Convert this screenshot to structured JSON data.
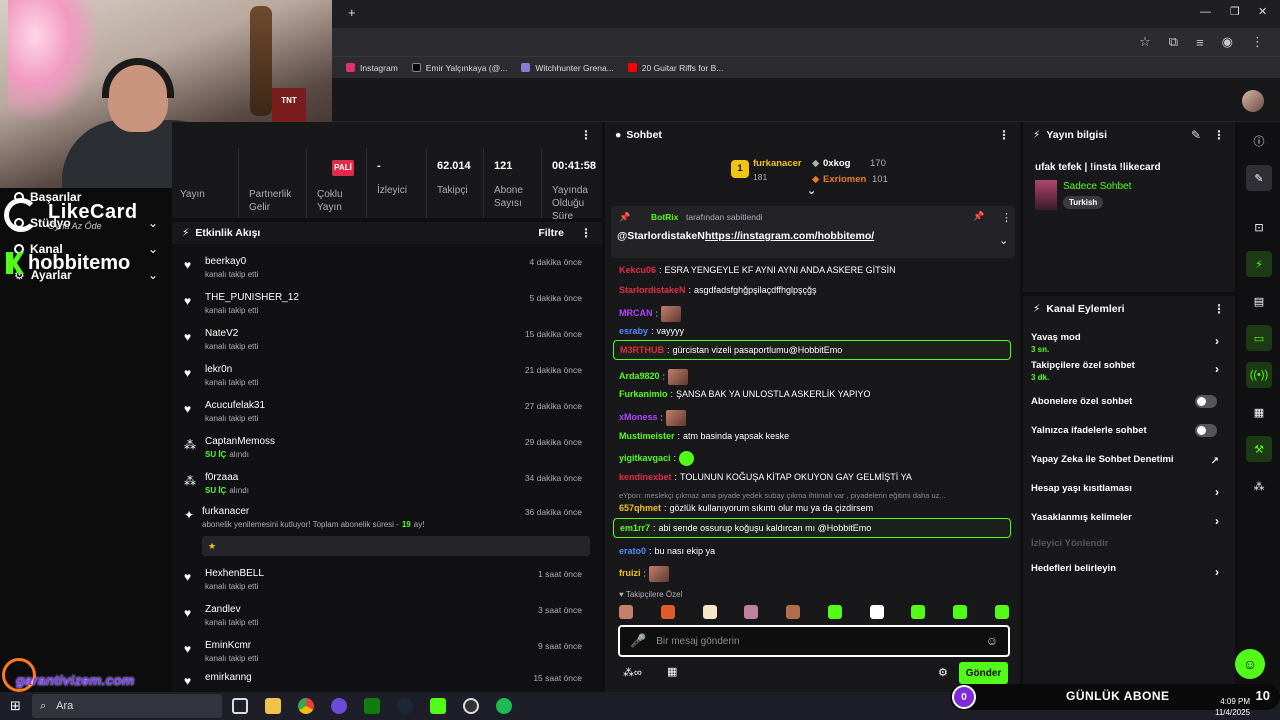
{
  "browser": {
    "bookmarks": [
      {
        "label": "Instagram",
        "color": "#e1306c"
      },
      {
        "label": "Emir Yalçınkaya (@...",
        "color": "#000000"
      },
      {
        "label": "Witchhunter Grena...",
        "color": "#8a7bd6"
      },
      {
        "label": "20 Guitar Riffs for B...",
        "color": "#ff0000"
      }
    ]
  },
  "overlay": {
    "likecard_title": "LikeCard",
    "likecard_sub": "Oyna  Az Öde",
    "hobbit_title": "hobbitemo",
    "garanti_text": "garantivizem.com",
    "gunluk_count": "0",
    "gunluk_label": "GÜNLÜK ABONE",
    "gunluk_total": "10"
  },
  "left_nav": [
    {
      "label": "Başarılar"
    },
    {
      "label": "Stüdyo"
    },
    {
      "label": "Kanal"
    },
    {
      "label": "Ayarlar"
    }
  ],
  "stats": {
    "pali": "PALİ",
    "items": [
      {
        "value": "",
        "label": "Yayın"
      },
      {
        "value": "",
        "label": "Partnerlik Gelir"
      },
      {
        "value": "",
        "label": "Çoklu Yayın"
      },
      {
        "value": "-",
        "label": "İzleyici"
      },
      {
        "value": "62.014",
        "label": "Takipçi"
      },
      {
        "value": "121",
        "label": "Abone Sayısı"
      },
      {
        "value": "00:41:58",
        "label": "Yayında Olduğu Süre"
      }
    ]
  },
  "activity": {
    "title": "Etkinlik Akışı",
    "filter": "Filtre",
    "rows": [
      {
        "name": "beerkay0",
        "sub": "kanalı takip etti",
        "time": "4 dakika önce",
        "icon": "heart-icon"
      },
      {
        "name": "THE_PUNISHER_12",
        "sub": "kanalı takip etti",
        "time": "5 dakika önce",
        "icon": "heart-icon"
      },
      {
        "name": "NateV2",
        "sub": "kanalı takip etti",
        "time": "15 dakika önce",
        "icon": "heart-icon"
      },
      {
        "name": "lekr0n",
        "sub": "kanalı takip etti",
        "time": "21 dakika önce",
        "icon": "heart-icon"
      },
      {
        "name": "Acucufelak31",
        "sub": "kanalı takip etti",
        "time": "27 dakika önce",
        "icon": "heart-icon"
      },
      {
        "name": "CaptanMemoss",
        "sub": "SU İÇ",
        "sub2": "alındı",
        "time": "29 dakika önce",
        "icon": "points-icon"
      },
      {
        "name": "f0rzaaa",
        "sub": "SU İÇ",
        "sub2": "alındı",
        "time": "34 dakika önce",
        "icon": "points-icon"
      },
      {
        "name": "furkanacer",
        "sub": "abonelik yenilemesini kutluyor! Toplam abonelik süresi -",
        "months": "19",
        "sub3": "ay!",
        "time": "36 dakika önce",
        "icon": "sub-icon"
      },
      {
        "name": "HexhenBELL",
        "sub": "kanalı takip etti",
        "time": "1 saat önce",
        "icon": "heart-icon"
      },
      {
        "name": "Zandlev",
        "sub": "kanalı takip etti",
        "time": "3 saat önce",
        "icon": "heart-icon"
      },
      {
        "name": "EminKcmr",
        "sub": "kanalı takip etti",
        "time": "9 saat önce",
        "icon": "heart-icon"
      },
      {
        "name": "emirkanng",
        "sub": "",
        "time": "15 saat önce",
        "icon": "heart-icon"
      }
    ]
  },
  "chat": {
    "title": "Sohbet",
    "leaderboard": [
      {
        "rank": "1",
        "name": "furkanacer",
        "count": "181"
      },
      {
        "name": "0xkog",
        "count": "170"
      },
      {
        "name": "Exriomen",
        "count": "101"
      }
    ],
    "pinned_by_user": "BotRix",
    "pinned_by_suffix": "tarafından sabitlendi",
    "pinned_sender": "@StarlordistakeN",
    "pinned_link": "https://instagram.com/hobbitemo/",
    "messages": [
      {
        "user": "Kekcu06",
        "color": "#e02c4a",
        "text": "ESRA YENGEYLE KF AYNI AYNI ANDA ASKERE GİTSİN"
      },
      {
        "user": "StarlordistakeN",
        "color": "#e02c4a",
        "text": "asgdfadsfghğpşilaçdffhglpşçğş"
      },
      {
        "user": "MRCAN",
        "color": "#b044ff",
        "text": ""
      },
      {
        "user": "esraby",
        "color": "#4a8cff",
        "text": "vayyyy"
      },
      {
        "user": "M3RTHUB",
        "color": "#e02c4a",
        "text": "gürcistan vizeli pasaportlumu@HobbitEmo"
      },
      {
        "user": "Arda9820",
        "color": "#53fc18",
        "text": ""
      },
      {
        "user": "Furkanimio",
        "color": "#53fc18",
        "text": "ŞANSA BAK YA UNLOSTLA ASKERLİK YAPIYO"
      },
      {
        "user": "xMoness",
        "color": "#b044ff",
        "text": ""
      },
      {
        "user": "Mustimeister",
        "color": "#53fc18",
        "text": "atm basinda yapsak keske"
      },
      {
        "user": "yigitkavgaci",
        "color": "#53fc18",
        "text": ""
      },
      {
        "user": "kendinexbet",
        "color": "#e02c4a",
        "text": "TOLUNUN KOĞUŞA KİTAP OKUYON GAY GELMİŞTİ YA"
      },
      {
        "reply": "eYpon: meslekçi çıkmaz ama piyade yedek subay çıkma ihtimali var , piyadelerin eğitimi daha uz..."
      },
      {
        "user": "657qhmet",
        "color": "#f1c40f",
        "text": "gözlük kullanıyorum sıkıntı olur mu ya da çizdirsem"
      },
      {
        "user": "em1rr7",
        "color": "#53fc18",
        "text": "abi sende ossurup koğuşu kaldırcan mı @HobbitEmo"
      },
      {
        "user": "erato0",
        "color": "#4a8cff",
        "text": "bu nası ekip ya"
      },
      {
        "user": "fruizi",
        "color": "#f1c40f",
        "text": ""
      }
    ],
    "followers_only": "Takipçilere Özel",
    "input_placeholder": "Bir mesaj gönderin",
    "send_label": "Gönder"
  },
  "info": {
    "title": "Yayın bilgisi",
    "stream_title": "ufak tefek | !insta !likecard",
    "category": "Sadece Sohbet",
    "language": "Turkish"
  },
  "actions": {
    "title": "Kanal Eylemleri",
    "items": [
      {
        "label": "Yavaş mod",
        "sub": "3 sn.",
        "type": "chev"
      },
      {
        "label": "Takipçilere özel sohbet",
        "sub": "3 dk.",
        "type": "chev"
      },
      {
        "label": "Abonelere özel sohbet",
        "type": "toggle"
      },
      {
        "label": "Yalnızca ifadelerle sohbet",
        "type": "toggle"
      },
      {
        "label": "Yapay Zeka ile Sohbet Denetimi",
        "type": "ext"
      },
      {
        "label": "Hesap yaşı kısıtlaması",
        "type": "chev"
      },
      {
        "label": "Yasaklanmış kelimeler",
        "type": "chev"
      },
      {
        "label": "İzleyici Yönlendir",
        "type": "none"
      },
      {
        "label": "Hedefleri belirleyin",
        "type": "chev"
      }
    ]
  },
  "taskbar": {
    "search_label": "Ara",
    "time": "4:09 PM",
    "date": "11/4/2025"
  }
}
